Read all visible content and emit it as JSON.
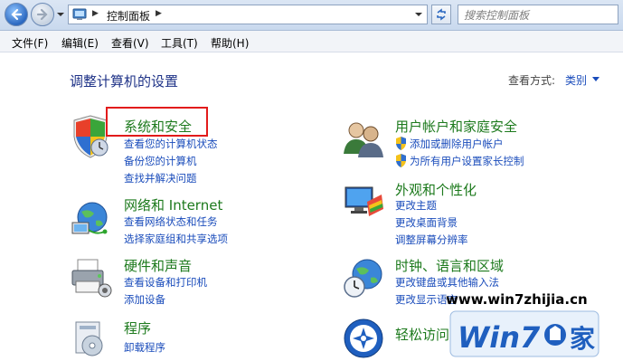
{
  "address": {
    "path": "控制面板",
    "search_placeholder": "搜索控制面板"
  },
  "menu": [
    "文件(F)",
    "编辑(E)",
    "查看(V)",
    "工具(T)",
    "帮助(H)"
  ],
  "main": {
    "title": "调整计算机的设置",
    "view_by_label": "查看方式:",
    "view_by_value": "类别"
  },
  "categories": {
    "system_security": {
      "title": "系统和安全",
      "links": [
        "查看您的计算机状态",
        "备份您的计算机",
        "查找并解决问题"
      ]
    },
    "network": {
      "title": "网络和 Internet",
      "links": [
        "查看网络状态和任务",
        "选择家庭组和共享选项"
      ]
    },
    "hardware": {
      "title": "硬件和声音",
      "links": [
        "查看设备和打印机",
        "添加设备"
      ]
    },
    "programs": {
      "title": "程序",
      "links": [
        "卸载程序"
      ]
    },
    "user_accounts": {
      "title": "用户帐户和家庭安全",
      "links": [
        "添加或删除用户帐户",
        "为所有用户设置家长控制"
      ]
    },
    "appearance": {
      "title": "外观和个性化",
      "links": [
        "更改主题",
        "更改桌面背景",
        "调整屏幕分辨率"
      ]
    },
    "clock": {
      "title": "时钟、语言和区域",
      "links": [
        "更改键盘或其他输入法",
        "更改显示语言"
      ]
    },
    "ease": {
      "title": "轻松访问"
    }
  },
  "watermark": {
    "url": "www.win7zhijia.cn",
    "logo_text": "Win7",
    "logo_suffix": "家"
  },
  "colors": {
    "link": "#1a4cbb",
    "category_title": "#1d7a1d",
    "page_title": "#1e3287",
    "highlight": "#e21b1b"
  }
}
